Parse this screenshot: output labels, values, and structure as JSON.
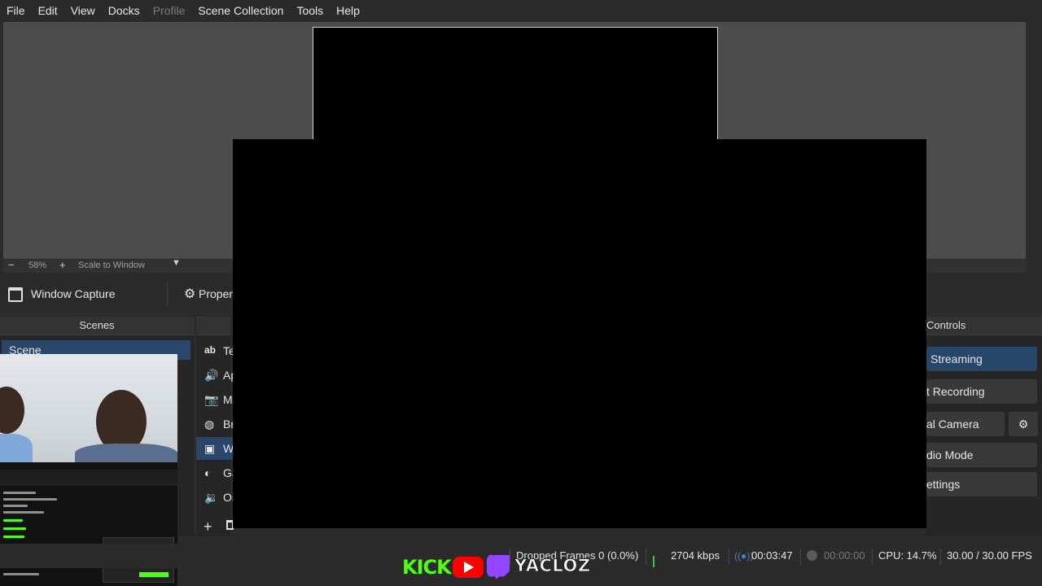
{
  "menu": [
    "File",
    "Edit",
    "View",
    "Docks",
    "Profile",
    "Scene Collection",
    "Tools",
    "Help"
  ],
  "preview_toolbar": {
    "zoom_out": "−",
    "zoom": "58%",
    "zoom_in": "+",
    "scale_mode": "Scale to Window"
  },
  "source_toolbar": {
    "source_name": "Window Capture",
    "properties_label": "Proper"
  },
  "scenes": {
    "title": "Scenes",
    "items": [
      "Scene"
    ]
  },
  "sources": {
    "items": [
      {
        "icon": "text-icon",
        "glyph": "ab",
        "label": "Te"
      },
      {
        "icon": "audio-icon",
        "glyph": "🔊",
        "label": "Ap"
      },
      {
        "icon": "camera-icon",
        "glyph": "📷",
        "label": "M"
      },
      {
        "icon": "browser-icon",
        "glyph": "◍",
        "label": "Br"
      },
      {
        "icon": "window-icon",
        "glyph": "▣",
        "label": "W"
      },
      {
        "icon": "gamepad-icon",
        "glyph": "◐",
        "label": "Ga"
      },
      {
        "icon": "speaker-icon",
        "glyph": "🔉",
        "label": "Os"
      }
    ]
  },
  "controls": {
    "title": "Controls",
    "title_visible": "Controls",
    "streaming": "Streaming",
    "recording": "t Recording",
    "virtual_camera": "al Camera",
    "studio_mode": "dio Mode",
    "settings": "Settings",
    "settings_visible": "ettings"
  },
  "status": {
    "dropped_frames": "Dropped Frames 0 (0.0%)",
    "bitrate": "2704 kbps",
    "stream_time": "00:03:47",
    "record_time": "00:00:00",
    "cpu": "CPU: 14.7%",
    "fps": "30.00 / 30.00 FPS"
  },
  "brand": {
    "kick": "KICK",
    "channel": "YACLOZ"
  },
  "colors": {
    "accent": "#2a466a",
    "kick_green": "#53fc18",
    "youtube_red": "#ff0000",
    "twitch_purple": "#9146ff",
    "bitrate_green": "#3cc83c",
    "stream_indicator": "#3f7fe0"
  }
}
